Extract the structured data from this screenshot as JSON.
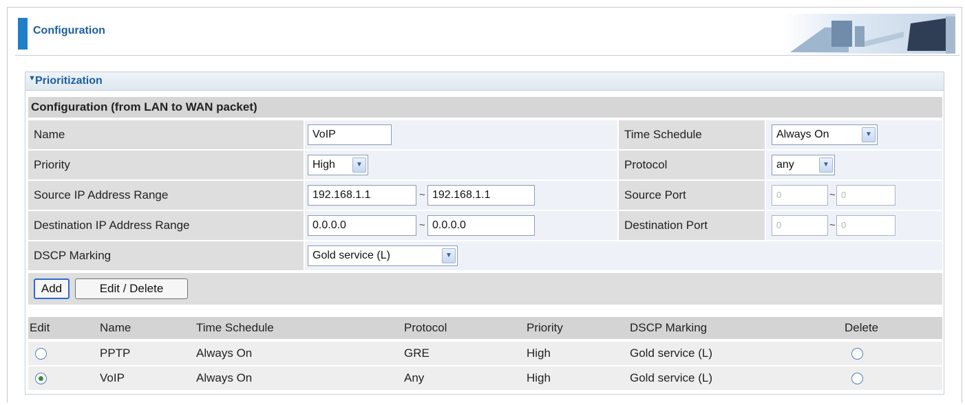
{
  "header": {
    "title": "Configuration"
  },
  "section": {
    "title": "Prioritization",
    "subtitle": "Configuration (from LAN to WAN packet)"
  },
  "form": {
    "name_label": "Name",
    "name_value": "VoIP",
    "time_schedule_label": "Time Schedule",
    "time_schedule_value": "Always On",
    "priority_label": "Priority",
    "priority_value": "High",
    "protocol_label": "Protocol",
    "protocol_value": "any",
    "source_ip_label": "Source IP Address Range",
    "source_ip_start": "192.168.1.1",
    "source_ip_end": "192.168.1.1",
    "source_port_label": "Source Port",
    "source_port_start": "0",
    "source_port_end": "0",
    "dest_ip_label": "Destination IP Address Range",
    "dest_ip_start": "0.0.0.0",
    "dest_ip_end": "0.0.0.0",
    "dest_port_label": "Destination Port",
    "dest_port_start": "0",
    "dest_port_end": "0",
    "dscp_label": "DSCP Marking",
    "dscp_value": "Gold service (L)",
    "range_sep": "~"
  },
  "buttons": {
    "add": "Add",
    "edit_delete": "Edit / Delete"
  },
  "table": {
    "headers": {
      "edit": "Edit",
      "name": "Name",
      "time_schedule": "Time Schedule",
      "protocol": "Protocol",
      "priority": "Priority",
      "dscp": "DSCP Marking",
      "delete": "Delete"
    },
    "rows": [
      {
        "edit_selected": false,
        "name": "PPTP",
        "time_schedule": "Always On",
        "protocol": "GRE",
        "priority": "High",
        "dscp": "Gold service (L)",
        "delete_selected": false
      },
      {
        "edit_selected": true,
        "name": "VoIP",
        "time_schedule": "Always On",
        "protocol": "Any",
        "priority": "High",
        "dscp": "Gold service (L)",
        "delete_selected": false
      }
    ]
  },
  "colors": {
    "accent": "#1e7fc8",
    "title": "#1a5f9e"
  },
  "icons": {
    "dropdown": "chevron-down-icon",
    "collapse": "triangle-down-icon",
    "radio": "radio-icon"
  }
}
